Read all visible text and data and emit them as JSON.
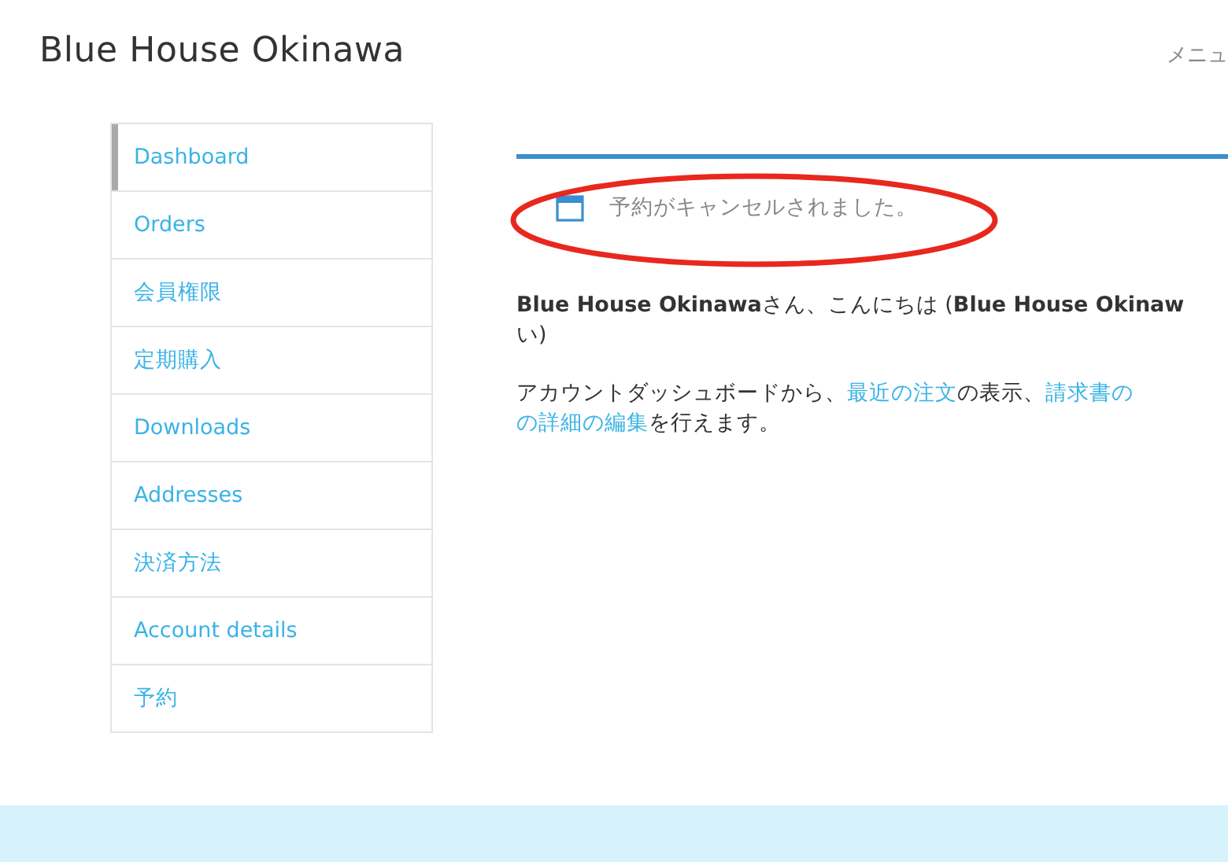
{
  "site_title": "Blue House Okinawa",
  "menu_label": "メニュ",
  "sidebar": {
    "items": [
      {
        "label": "Dashboard",
        "selected": true
      },
      {
        "label": "Orders",
        "selected": false
      },
      {
        "label": "会員権限",
        "selected": false
      },
      {
        "label": "定期購入",
        "selected": false
      },
      {
        "label": "Downloads",
        "selected": false
      },
      {
        "label": "Addresses",
        "selected": false
      },
      {
        "label": "決済方法",
        "selected": false
      },
      {
        "label": "Account details",
        "selected": false
      },
      {
        "label": "予約",
        "selected": false
      }
    ]
  },
  "notice": {
    "message": "予約がキャンセルされました。",
    "highlighted": true
  },
  "greeting": {
    "lines": [
      "**Blue House Okinawa**さん、こんにちは (**Blue House Okinaw**",
      "い)"
    ]
  },
  "intro": {
    "lines": [
      [
        {
          "kind": "text",
          "text": "アカウントダッシュボードから、"
        },
        {
          "kind": "link",
          "text": "最近の注文"
        },
        {
          "kind": "text",
          "text": "の表示、"
        },
        {
          "kind": "link",
          "text": "請求書の"
        }
      ],
      [
        {
          "kind": "link",
          "text": "の詳細の編集"
        },
        {
          "kind": "text",
          "text": "を行えます。"
        }
      ]
    ]
  }
}
